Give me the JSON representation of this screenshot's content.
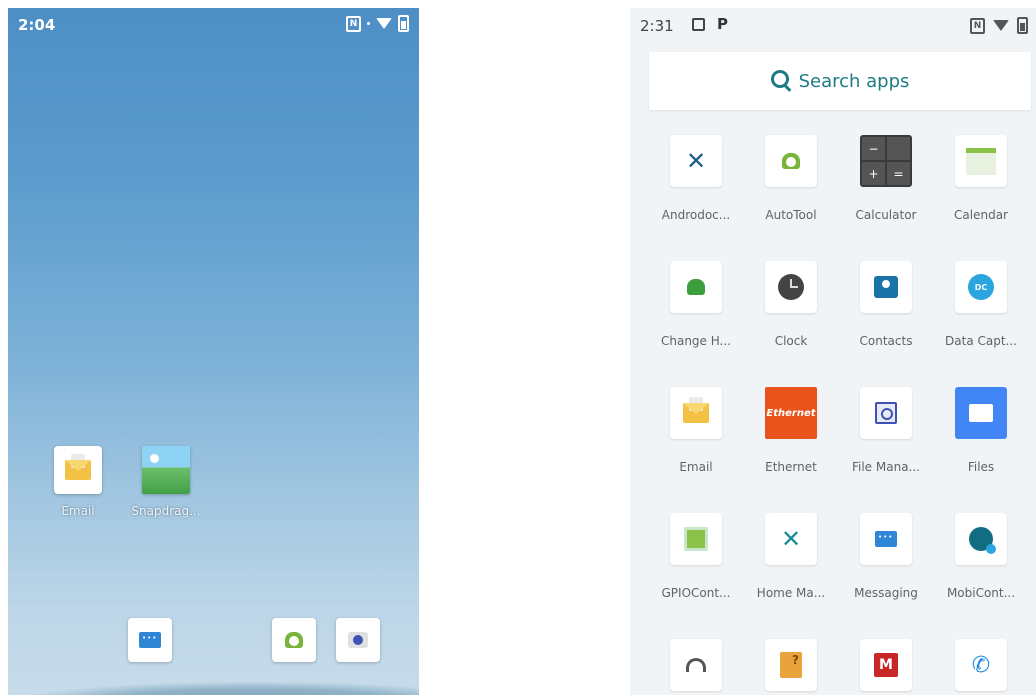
{
  "home": {
    "status": {
      "time": "2:04",
      "nfc": "N"
    },
    "apps": [
      {
        "label": "Email",
        "icon": "email-icon"
      },
      {
        "label": "Snapdrag...",
        "icon": "gallery-icon"
      }
    ],
    "dock": [
      {
        "icon": "messaging-icon"
      },
      {
        "icon": "autotool-icon"
      },
      {
        "icon": "camera-icon"
      }
    ]
  },
  "drawer": {
    "status": {
      "time": "2:31",
      "nfc": "N"
    },
    "search_placeholder": "Search apps",
    "apps": [
      {
        "label": "Androdoc...",
        "icon": "androdoc-icon"
      },
      {
        "label": "AutoTool",
        "icon": "autotool-icon"
      },
      {
        "label": "Calculator",
        "icon": "calculator-icon"
      },
      {
        "label": "Calendar",
        "icon": "calendar-icon"
      },
      {
        "label": "Change H...",
        "icon": "android-icon"
      },
      {
        "label": "Clock",
        "icon": "clock-icon"
      },
      {
        "label": "Contacts",
        "icon": "contacts-icon"
      },
      {
        "label": "Data Capt...",
        "icon": "datawedge-icon"
      },
      {
        "label": "Email",
        "icon": "email-icon"
      },
      {
        "label": "Ethernet",
        "icon": "ethernet-icon",
        "icon_text": "Ethernet"
      },
      {
        "label": "File Mana...",
        "icon": "file-manager-icon"
      },
      {
        "label": "Files",
        "icon": "files-icon"
      },
      {
        "label": "GPIOCont...",
        "icon": "gpio-icon"
      },
      {
        "label": "Home Ma...",
        "icon": "tools-icon"
      },
      {
        "label": "Messaging",
        "icon": "messaging-icon"
      },
      {
        "label": "MobiCont...",
        "icon": "mobicontrol-icon"
      },
      {
        "label": "",
        "icon": "headset-icon"
      },
      {
        "label": "",
        "icon": "help-doc-icon"
      },
      {
        "label": "",
        "icon": "m-app-icon"
      },
      {
        "label": "",
        "icon": "phone-icon"
      }
    ]
  }
}
